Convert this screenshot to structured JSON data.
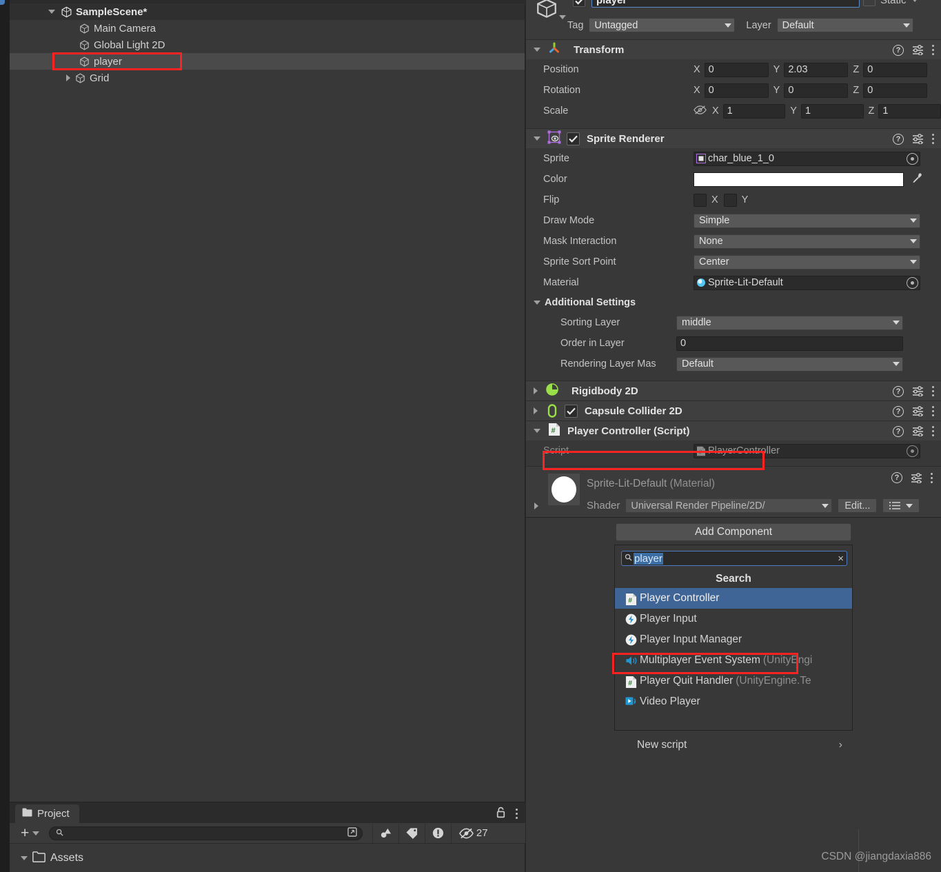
{
  "hierarchy": {
    "panel_name": "Hierarchy",
    "rows": [
      {
        "label": "SampleScene*",
        "icon": "unity-scene-icon",
        "indent": 56,
        "expanded": true,
        "has_arrow": true,
        "bold": true,
        "selected": false
      },
      {
        "label": "Main Camera",
        "icon": "gameobject-cube-icon",
        "indent": 100,
        "expanded": false,
        "has_arrow": false,
        "bold": false,
        "selected": false
      },
      {
        "label": "Global Light 2D",
        "icon": "gameobject-cube-icon",
        "indent": 100,
        "expanded": false,
        "has_arrow": false,
        "bold": false,
        "selected": false
      },
      {
        "label": "player",
        "icon": "gameobject-cube-icon",
        "indent": 100,
        "expanded": false,
        "has_arrow": false,
        "bold": false,
        "selected": true
      },
      {
        "label": "Grid",
        "icon": "gameobject-cube-icon",
        "indent": 100,
        "expanded": false,
        "has_arrow": true,
        "bold": false,
        "selected": false
      }
    ]
  },
  "project": {
    "tab_label": "Project",
    "search_placeholder": "",
    "search_value": "",
    "hidden_count": "27",
    "assets_label": "Assets"
  },
  "inspector": {
    "object": {
      "name_value": "player",
      "enabled": true,
      "static_label": "Static",
      "static_checked": false,
      "tag_label": "Tag",
      "tag_value": "Untagged",
      "layer_label": "Layer",
      "layer_value": "Default"
    },
    "transform": {
      "title": "Transform",
      "expanded": true,
      "rows": [
        {
          "name": "Position",
          "x": "0",
          "y": "2.03",
          "z": "0"
        },
        {
          "name": "Rotation",
          "x": "0",
          "y": "0",
          "z": "0"
        },
        {
          "name": "Scale",
          "x": "1",
          "y": "1",
          "z": "1"
        }
      ],
      "axis_labels": [
        "X",
        "Y",
        "Z"
      ]
    },
    "sprite_renderer": {
      "title": "Sprite Renderer",
      "enabled": true,
      "expanded": true,
      "sprite_label": "Sprite",
      "sprite_value": "char_blue_1_0",
      "color_label": "Color",
      "color_value": "#ffffff",
      "flip_label": "Flip",
      "flip_x_label": "X",
      "flip_y_label": "Y",
      "flip_x": false,
      "flip_y": false,
      "draw_mode_label": "Draw Mode",
      "draw_mode_value": "Simple",
      "mask_interaction_label": "Mask Interaction",
      "mask_interaction_value": "None",
      "sort_point_label": "Sprite Sort Point",
      "sort_point_value": "Center",
      "material_label": "Material",
      "material_value": "Sprite-Lit-Default",
      "additional_settings_label": "Additional Settings",
      "sorting_layer_label": "Sorting Layer",
      "sorting_layer_value": "middle",
      "order_in_layer_label": "Order in Layer",
      "order_in_layer_value": "0",
      "rendering_layer_label": "Rendering Layer Mas",
      "rendering_layer_value": "Default"
    },
    "rigidbody2d": {
      "title": "Rigidbody 2D",
      "expanded": false
    },
    "capsule_collider2d": {
      "title": "Capsule Collider 2D",
      "enabled": true,
      "expanded": false
    },
    "player_controller": {
      "title": "Player Controller (Script)",
      "expanded": true,
      "script_label": "Script",
      "script_value": "PlayerController",
      "highlighted": true
    },
    "material_preview": {
      "title": "Sprite-Lit-Default",
      "title_suffix": "(Material)",
      "shader_label": "Shader",
      "shader_value": "Universal Render Pipeline/2D/",
      "edit_button": "Edit..."
    },
    "add_component": {
      "button_label": "Add Component",
      "search_value": "player",
      "search_clear_glyph": "×",
      "search_header": "Search",
      "items": [
        {
          "label": "Player Controller",
          "suffix": "",
          "icon": "cs-script-icon",
          "selected": true,
          "highlighted": true
        },
        {
          "label": "Player Input",
          "suffix": "",
          "icon": "input-bolt-icon",
          "selected": false,
          "highlighted": false
        },
        {
          "label": "Player Input Manager",
          "suffix": "",
          "icon": "input-bolt-icon",
          "selected": false,
          "highlighted": false
        },
        {
          "label": "Multiplayer Event System",
          "suffix": "(UnityEngi",
          "icon": "event-system-icon",
          "selected": false,
          "highlighted": false
        },
        {
          "label": "Player Quit Handler",
          "suffix": "(UnityEngine.Te",
          "icon": "cs-script-icon",
          "selected": false,
          "highlighted": false
        },
        {
          "label": "Video Player",
          "suffix": "",
          "icon": "video-player-icon",
          "selected": false,
          "highlighted": false
        }
      ],
      "new_script_label": "New script",
      "new_script_chevron": "›"
    }
  },
  "watermark": "CSDN @jiangdaxia886",
  "colors": {
    "panel_bg": "#383838",
    "header_bg": "#3f3f3f",
    "field_bg": "#2a2a2a",
    "popup_bg": "#585858",
    "selection_blue": "#3f6596",
    "highlight_red": "#ff2222",
    "text": "#c4c4c4",
    "unity_green": "#8fd14f"
  }
}
